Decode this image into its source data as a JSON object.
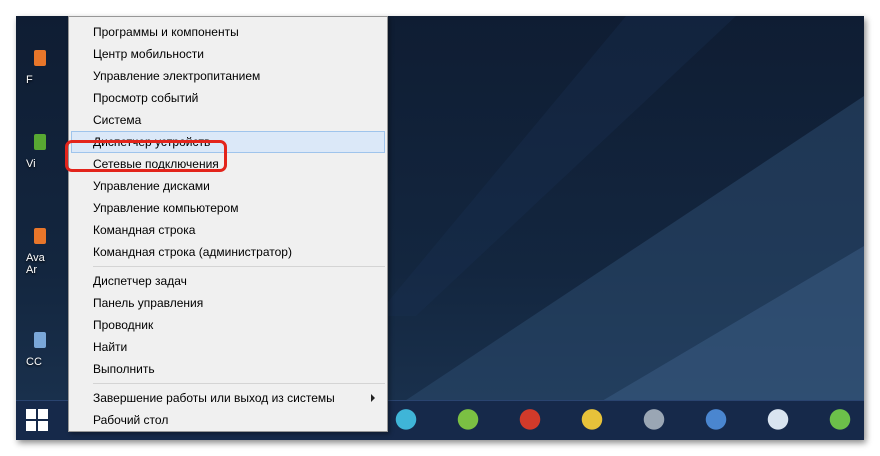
{
  "desktop_icons": [
    {
      "label": "F",
      "color": "#e8762a"
    },
    {
      "label": "Vi",
      "color": "#58a832"
    },
    {
      "label": "Ava\nAr",
      "color": "#e8762a"
    },
    {
      "label": "CC",
      "color": "#7aa7d8"
    }
  ],
  "context_menu": {
    "groups": [
      [
        "Программы и компоненты",
        "Центр мобильности",
        "Управление электропитанием",
        "Просмотр событий",
        "Система",
        "Диспетчер устройств",
        "Сетевые подключения",
        "Управление дисками",
        "Управление компьютером",
        "Командная строка",
        "Командная строка (администратор)"
      ],
      [
        "Диспетчер задач",
        "Панель управления",
        "Проводник",
        "Найти",
        "Выполнить"
      ],
      [
        "Завершение работы или выход из системы",
        "Рабочий стол"
      ]
    ],
    "highlighted": "Диспетчер устройств",
    "submenu_item": "Завершение работы или выход из системы"
  },
  "taskbar_icons": [
    {
      "name": "vlc-icon",
      "color": "#3fb5d8"
    },
    {
      "name": "chart-edit-icon",
      "color": "#7bc043"
    },
    {
      "name": "red-green-icon",
      "color": "#d23a2a"
    },
    {
      "name": "magnifier-icon",
      "color": "#e7c23a"
    },
    {
      "name": "padlock-icon",
      "color": "#9aa6b4"
    },
    {
      "name": "globe-icon",
      "color": "#4a86d0"
    },
    {
      "name": "virtualbox-icon",
      "color": "#d9e4f0"
    },
    {
      "name": "feed-icon",
      "color": "#6cc04a"
    }
  ],
  "accent": "#e3241b"
}
